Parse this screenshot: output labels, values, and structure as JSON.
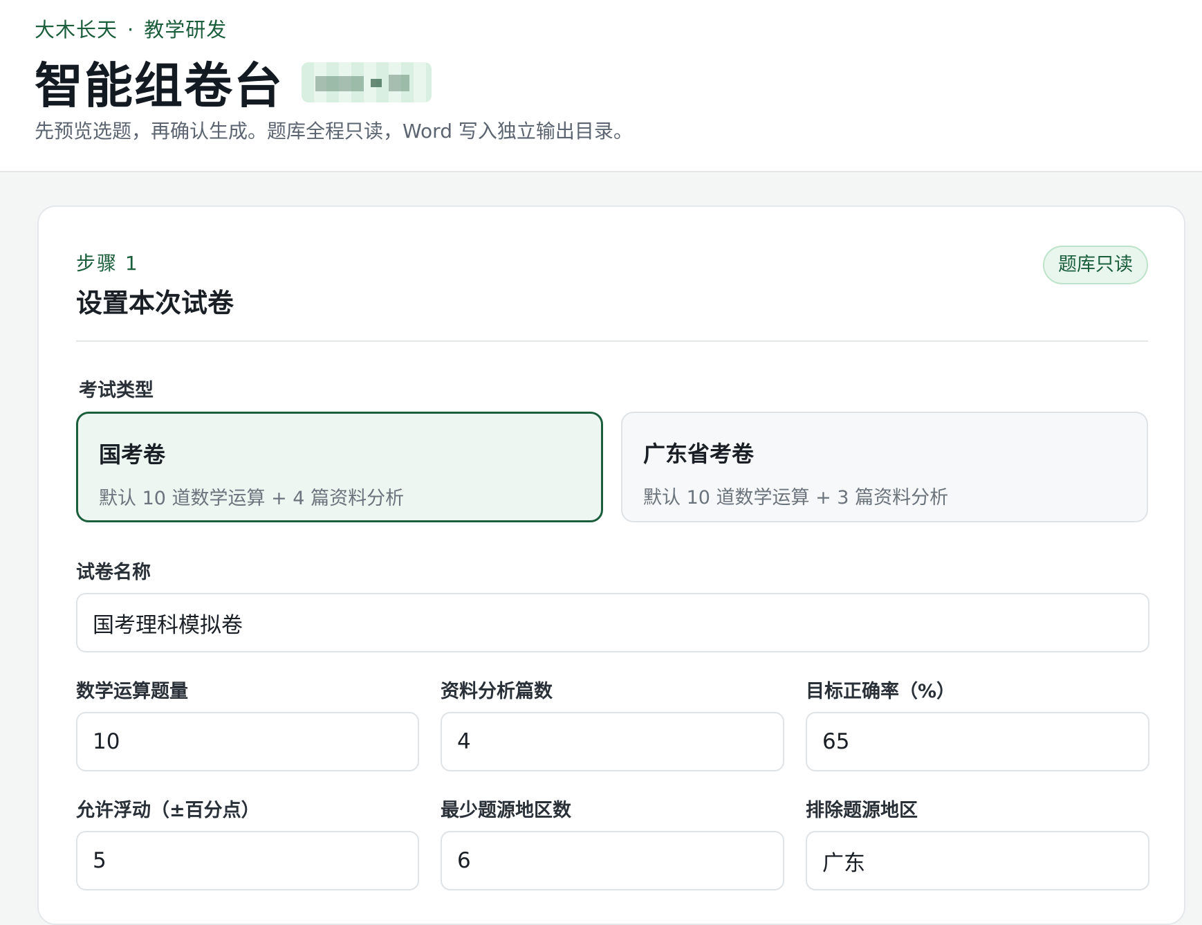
{
  "header": {
    "org": "大木长天",
    "dept": "教学研发",
    "separator": "·",
    "title": "智能组卷台",
    "subtitle": "先预览选题，再确认生成。题库全程只读，Word 写入独立输出目录。"
  },
  "step": {
    "label": "步骤 1",
    "title": "设置本次试卷",
    "badge": "题库只读"
  },
  "exam_type": {
    "label": "考试类型",
    "options": [
      {
        "title": "国考卷",
        "desc": "默认 10 道数学运算 + 4 篇资料分析",
        "selected": true
      },
      {
        "title": "广东省考卷",
        "desc": "默认 10 道数学运算 + 3 篇资料分析",
        "selected": false
      }
    ]
  },
  "paper_name": {
    "label": "试卷名称",
    "value": "国考理科模拟卷"
  },
  "fields": [
    {
      "label": "数学运算题量",
      "value": "10"
    },
    {
      "label": "资料分析篇数",
      "value": "4"
    },
    {
      "label": "目标正确率（%）",
      "value": "65"
    },
    {
      "label": "允许浮动（±百分点）",
      "value": "5"
    },
    {
      "label": "最少题源地区数",
      "value": "6"
    },
    {
      "label": "排除题源地区",
      "value": "广东"
    }
  ],
  "colors": {
    "accent": "#1b5e3b",
    "accent_light": "#edf6f0"
  }
}
